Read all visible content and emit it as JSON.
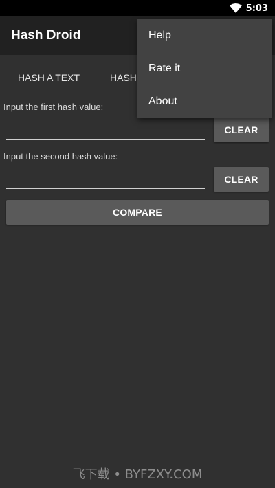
{
  "status_bar": {
    "time": "5:03",
    "wifi_icon": "wifi-icon"
  },
  "app_bar": {
    "title": "Hash Droid"
  },
  "tabs": [
    {
      "label": "HASH A TEXT"
    },
    {
      "label": "HASH"
    }
  ],
  "compare_form": {
    "first_label": "Input the first hash value:",
    "first_value": "",
    "second_label": "Input the second hash value:",
    "second_value": "",
    "clear_label": "CLEAR",
    "compare_label": "COMPARE"
  },
  "overflow_menu": {
    "items": [
      {
        "label": "Help"
      },
      {
        "label": "Rate it"
      },
      {
        "label": "About"
      }
    ]
  },
  "watermark": {
    "text": "飞下载 • BYFZXY.COM"
  },
  "colors": {
    "background": "#303030",
    "app_bar": "#212121",
    "menu": "#424242",
    "button": "#5a5a5a",
    "status_bar": "#000000"
  }
}
